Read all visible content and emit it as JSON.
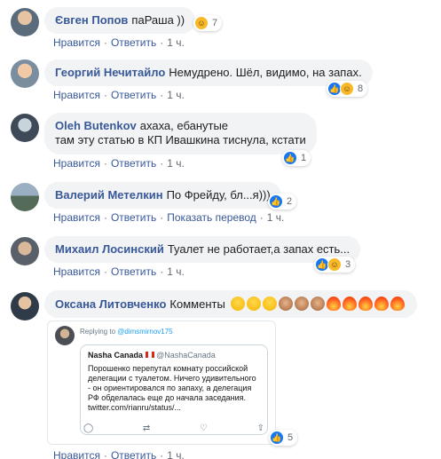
{
  "comments": [
    {
      "author": "Євген Попов",
      "text": "паРаша ))",
      "actions": {
        "like": "Нравится",
        "reply": "Ответить",
        "time": "1 ч."
      },
      "reactions": {
        "icons": [
          "haha"
        ],
        "count": "7"
      }
    },
    {
      "author": "Георгий Нечитайло",
      "text": "Немудрено. Шёл, видимо, на запах.",
      "actions": {
        "like": "Нравится",
        "reply": "Ответить",
        "time": "1 ч."
      },
      "reactions": {
        "icons": [
          "like",
          "haha"
        ],
        "count": "8"
      }
    },
    {
      "author": "Oleh Butenkov",
      "text_line1": "ахаха, ебанутые",
      "text_line2": "там эту статью в КП Ивашкина тиснула, кстати",
      "actions": {
        "like": "Нравится",
        "reply": "Ответить",
        "time": "1 ч."
      },
      "reactions": {
        "icons": [
          "like"
        ],
        "count": "1"
      }
    },
    {
      "author": "Валерий Метелкин",
      "text": "По Фрейду, бл...я)))",
      "actions": {
        "like": "Нравится",
        "reply": "Ответить",
        "translate": "Показать перевод",
        "time": "1 ч."
      },
      "reactions": {
        "icons": [
          "like"
        ],
        "count": "2"
      }
    },
    {
      "author": "Михаил Лосинский",
      "text": "Туалет не работает,а запах есть...",
      "actions": {
        "like": "Нравится",
        "reply": "Ответить",
        "time": "1 ч."
      },
      "reactions": {
        "icons": [
          "like",
          "haha"
        ],
        "count": "3"
      }
    },
    {
      "author": "Оксана Литовченко",
      "text": "Комменты",
      "emojis": [
        "face-with-tears-of-joy",
        "face-with-tears-of-joy",
        "face-with-tears-of-joy",
        "see-no-evil-monkey",
        "see-no-evil-monkey",
        "see-no-evil-monkey",
        "fire",
        "fire",
        "fire",
        "fire",
        "fire"
      ],
      "actions": {
        "like": "Нравится",
        "reply": "Ответить",
        "time": "1 ч."
      },
      "reactions": {
        "icons": [
          "like"
        ],
        "count": "5"
      },
      "attachment": {
        "replying_prefix": "Replying to",
        "replying_handle": "@dimsmirnov175",
        "quoted_name": "Nasha Canada",
        "quoted_handle": "@NashaCanada",
        "quoted_text_lines": [
          "Порошенко перепутал комнату российской",
          "делегации с туалетом. Ничего удивительного",
          "- он ориентировался по запаху, а делегация",
          "РФ обделалась еще до начала заседания.",
          "twitter.com/rianru/status/..."
        ]
      }
    }
  ],
  "colors": {
    "author": "#385898",
    "bubble": "#f2f3f5",
    "meta": "#606770",
    "like": "#1877f2",
    "haha": "#f7b928"
  }
}
